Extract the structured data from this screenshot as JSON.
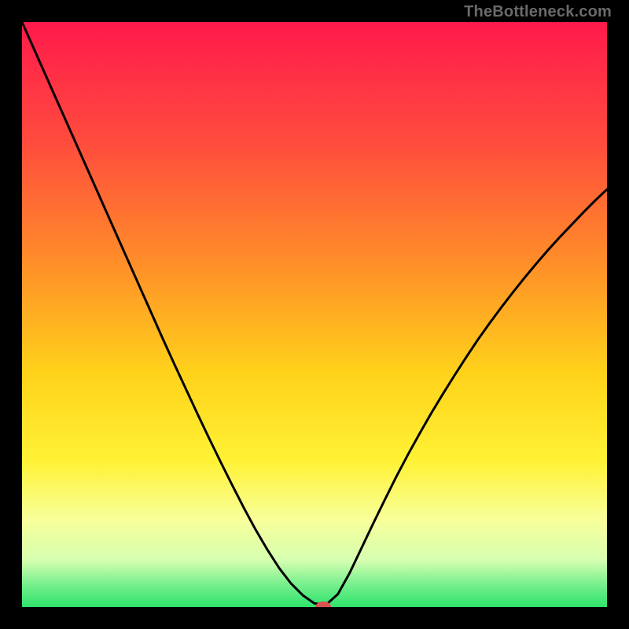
{
  "watermark": "TheBottleneck.com",
  "chart_data": {
    "type": "line",
    "title": "",
    "xlabel": "",
    "ylabel": "",
    "xlim": [
      0,
      100
    ],
    "ylim": [
      0,
      100
    ],
    "series": [
      {
        "name": "curve",
        "x": [
          0,
          2,
          4,
          6,
          8,
          10,
          12,
          14,
          16,
          18,
          20,
          22,
          24,
          26,
          28,
          30,
          32,
          34,
          36,
          38,
          40,
          42,
          44,
          46,
          48,
          50,
          52,
          54,
          56,
          58,
          60,
          62,
          64,
          66,
          68,
          70,
          72,
          74,
          76,
          78,
          80,
          82,
          84,
          86,
          88,
          90,
          92,
          94,
          96,
          98,
          100
        ],
        "y": [
          100,
          95.5,
          91,
          86.5,
          82,
          77.5,
          73,
          68.5,
          64,
          59.5,
          55,
          50.5,
          46,
          41.6,
          37.3,
          33,
          28.8,
          24.7,
          20.7,
          16.8,
          13.1,
          9.7,
          6.6,
          4.0,
          2.0,
          0.6,
          0.4,
          2.2,
          5.8,
          10.0,
          14.2,
          18.3,
          22.3,
          26.1,
          29.7,
          33.2,
          36.5,
          39.7,
          42.8,
          45.8,
          48.6,
          51.3,
          53.9,
          56.4,
          58.8,
          61.1,
          63.3,
          65.4,
          67.5,
          69.5,
          71.4
        ]
      }
    ],
    "marker": {
      "x": 51.5,
      "y": 0.0,
      "color": "#d9534f"
    },
    "background": {
      "gradient_stops": [
        {
          "offset": 0.0,
          "color": "#ff1a4b"
        },
        {
          "offset": 0.2,
          "color": "#ff4a3e"
        },
        {
          "offset": 0.4,
          "color": "#ff8a2a"
        },
        {
          "offset": 0.6,
          "color": "#ffd21a"
        },
        {
          "offset": 0.75,
          "color": "#fff235"
        },
        {
          "offset": 0.85,
          "color": "#f8ff9a"
        },
        {
          "offset": 0.92,
          "color": "#d6ffb0"
        },
        {
          "offset": 0.96,
          "color": "#7af08f"
        },
        {
          "offset": 1.0,
          "color": "#2ee36b"
        }
      ]
    }
  }
}
